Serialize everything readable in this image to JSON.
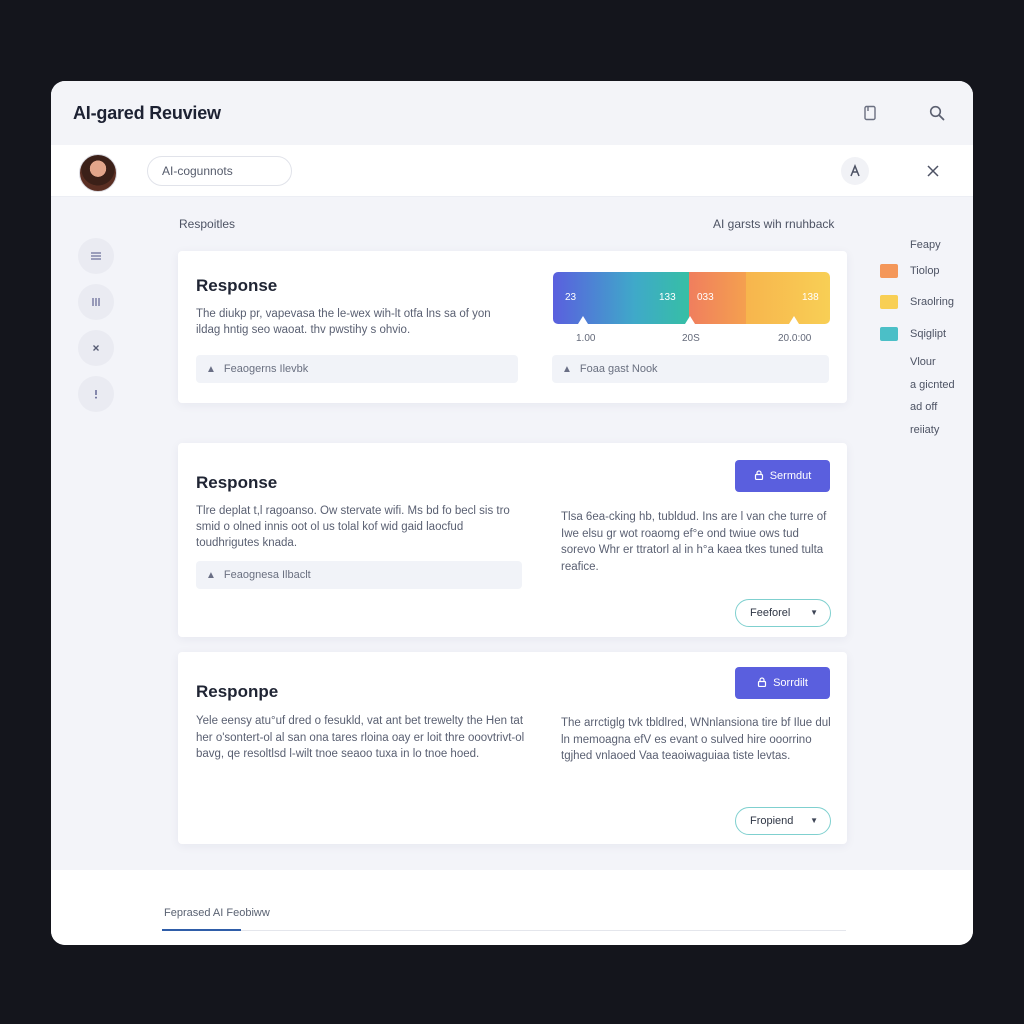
{
  "app": {
    "title": "AI-gared Reuview"
  },
  "subbar": {
    "search_value": "AI-cogunnots"
  },
  "main": {
    "left_label": "Respoitles",
    "right_label": "AI garsts wih rnuhback"
  },
  "cards": [
    {
      "title": "Response",
      "text": "The diukp pr, vapevasa the le-wex wih-lt otfa lns sa of yon ildag hntig seo waoat. thv pwstihy s ohvio.",
      "feedback_left": "Feaogerns Ilevbk",
      "feedback_right": "Foaa gast Nook",
      "bar_values": [
        "23",
        "133",
        "033",
        "138"
      ],
      "ticks": [
        "1.00",
        "20S",
        "20.0:00"
      ]
    },
    {
      "title": "Response",
      "text": "Tlre deplat t,l ragoanso. Ow stervate wifi. Ms bd fo becl sis tro smid o olned innis oot ol us tolal kof wid gaid laocfud toudhrigutes knada.",
      "feedback_left": "Feaognesa Ilbaclt",
      "right_text": "Tlsa 6ea-cking hb, tubldud. Ins are l van che turre of Iwe elsu gr wot roaomg ef°e ond twiue ows tud sorevo Whr er ttratorl al in h°a kaea tkes tuned tulta reafice.",
      "submit_label": "Sermdut",
      "dropdown_label": "Feeforel"
    },
    {
      "title": "Responpe",
      "text": "Yele eensy atu°uf dred o fesukld, vat ant bet trewelty the Hen tat her o'sontert-ol al san ona tares rloina oay er loit thre ooovtrivt-ol bavg, qe resoltlsd l-wilt tnoe seaoo tuxa in lo tnoe hoed.",
      "right_text": "The arrctiglg tvk tbldlred, WNnlansiona tire bf Ilue dul ln memoagna efV es evant o sulved hire ooorrino tgjhed vnlaoed Vaa teaoiwaguiaa tiste levtas.",
      "submit_label": "Sorrdilt",
      "dropdown_label": "Fropiend"
    }
  ],
  "legend": {
    "title": "Feapy",
    "items": [
      {
        "label": "Tiolop",
        "color": "#f4975a"
      },
      {
        "label": "Sraolring",
        "color": "#f8cf55"
      },
      {
        "label": "Sqiglipt",
        "color": "#4bbfc7"
      }
    ],
    "note_lines": [
      "Vlour",
      "a gicnted",
      "ad off",
      "reiiaty"
    ]
  },
  "footer": {
    "tab_label": "Feprased AI Feobiww"
  },
  "colors": {
    "accent": "#5a5fde",
    "teal_outline": "#7fd0cf",
    "footer_active": "#2f5da8"
  },
  "icons": [
    "bookmark-icon",
    "search-icon",
    "a-icon",
    "close-icon",
    "menu-icon",
    "columns-icon",
    "x-icon",
    "alert-icon",
    "person-icon",
    "lock-icon",
    "chevron-down-icon"
  ]
}
